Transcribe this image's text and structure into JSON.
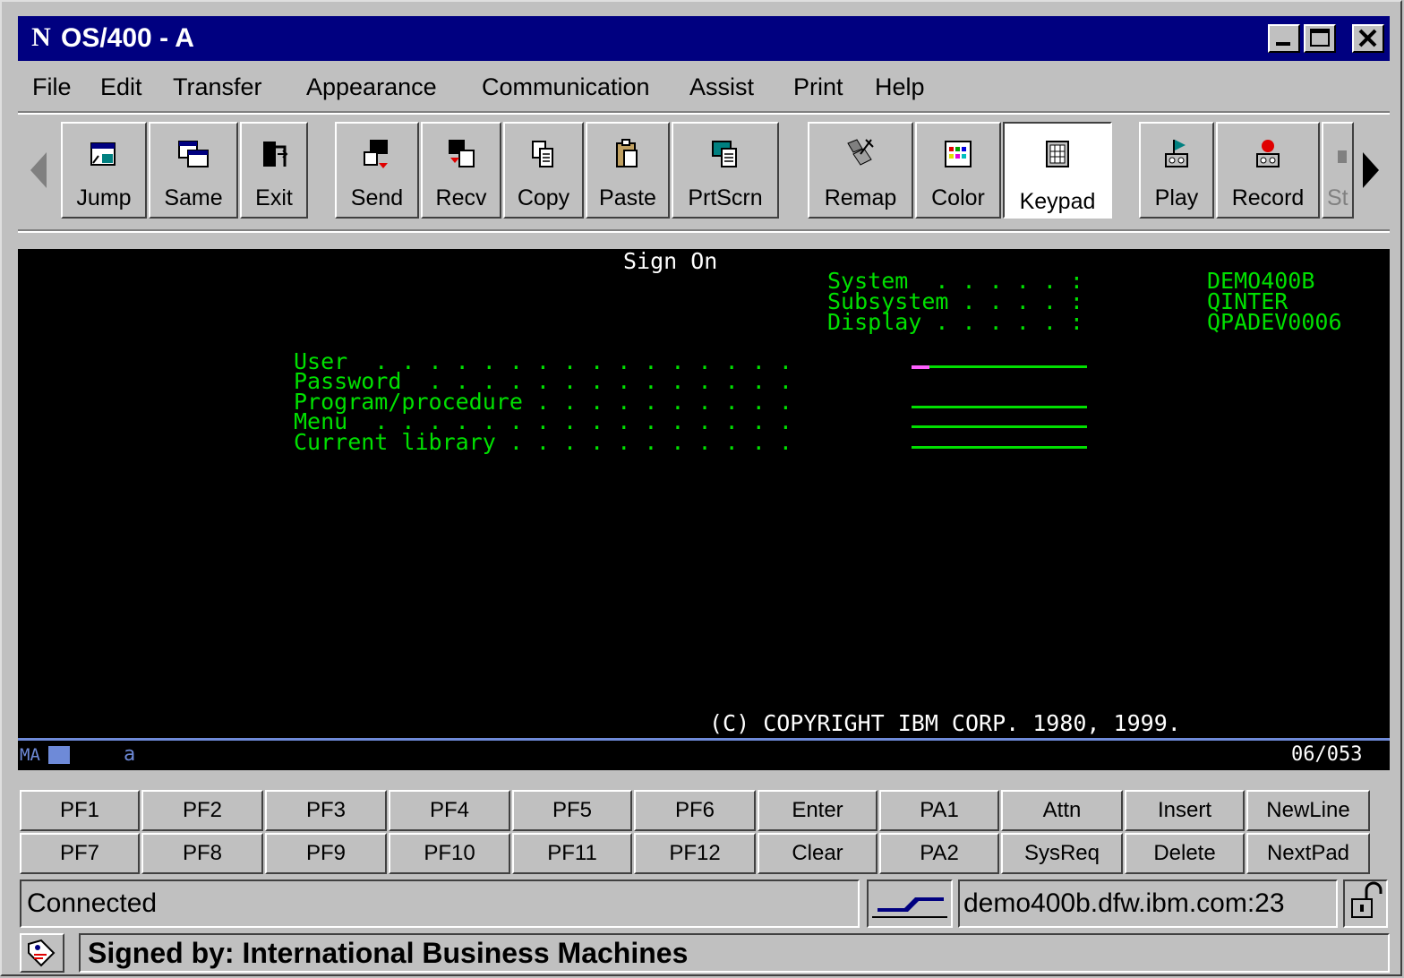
{
  "window": {
    "title": "OS/400 - A",
    "app_icon_glyph": "N",
    "controls": [
      "minimize",
      "maximize",
      "close"
    ]
  },
  "menu": {
    "items": [
      "File",
      "Edit",
      "Transfer",
      "Appearance",
      "Communication",
      "Assist",
      "Print",
      "Help"
    ]
  },
  "toolbar": {
    "buttons": [
      {
        "label": "Jump",
        "icon": "jump-icon"
      },
      {
        "label": "Same",
        "icon": "same-icon"
      },
      {
        "label": "Exit",
        "icon": "exit-icon"
      },
      {
        "label": "Send",
        "icon": "send-icon"
      },
      {
        "label": "Recv",
        "icon": "receive-icon"
      },
      {
        "label": "Copy",
        "icon": "copy-icon"
      },
      {
        "label": "Paste",
        "icon": "paste-icon"
      },
      {
        "label": "PrtScrn",
        "icon": "print-screen-icon"
      },
      {
        "label": "Remap",
        "icon": "remap-icon"
      },
      {
        "label": "Color",
        "icon": "color-icon"
      },
      {
        "label": "Keypad",
        "icon": "keypad-icon",
        "pressed": true
      },
      {
        "label": "Play",
        "icon": "play-icon"
      },
      {
        "label": "Record",
        "icon": "record-icon"
      },
      {
        "label": "St",
        "icon": "stop-icon"
      }
    ]
  },
  "terminal": {
    "title": "Sign On",
    "system_info": [
      {
        "label": "System  . . . . . :",
        "value": "DEMO400B"
      },
      {
        "label": "Subsystem . . . . :",
        "value": "QINTER"
      },
      {
        "label": "Display . . . . . :",
        "value": "QPADEV0006"
      }
    ],
    "fields": [
      {
        "label": "User  . . . . . . . . . . . . . . . ."
      },
      {
        "label": "Password  . . . . . . . . . . . . . ."
      },
      {
        "label": "Program/procedure . . . . . . . . . ."
      },
      {
        "label": "Menu  . . . . . . . . . . . . . . . ."
      },
      {
        "label": "Current library . . . . . . . . . . ."
      }
    ],
    "copyright": "(C) COPYRIGHT IBM CORP. 1980, 1999."
  },
  "oia": {
    "indicator": "MA",
    "session": "a",
    "cursor_position": "06/053"
  },
  "keypad": {
    "row1": [
      "PF1",
      "PF2",
      "PF3",
      "PF4",
      "PF5",
      "PF6",
      "Enter",
      "PA1",
      "Attn",
      "Insert",
      "NewLine"
    ],
    "row2": [
      "PF7",
      "PF8",
      "PF9",
      "PF10",
      "PF11",
      "PF12",
      "Clear",
      "PA2",
      "SysReq",
      "Delete",
      "NextPad"
    ]
  },
  "status": {
    "connection": "Connected",
    "host": "demo400b.dfw.ibm.com:23"
  },
  "applet": {
    "signed_by": "Signed by: International Business Machines"
  },
  "colors": {
    "titlebar": "#000080",
    "terminal_bg": "#000000",
    "terminal_green": "#00e000",
    "terminal_white": "#ffffff",
    "cursor": "#ff60ff"
  }
}
